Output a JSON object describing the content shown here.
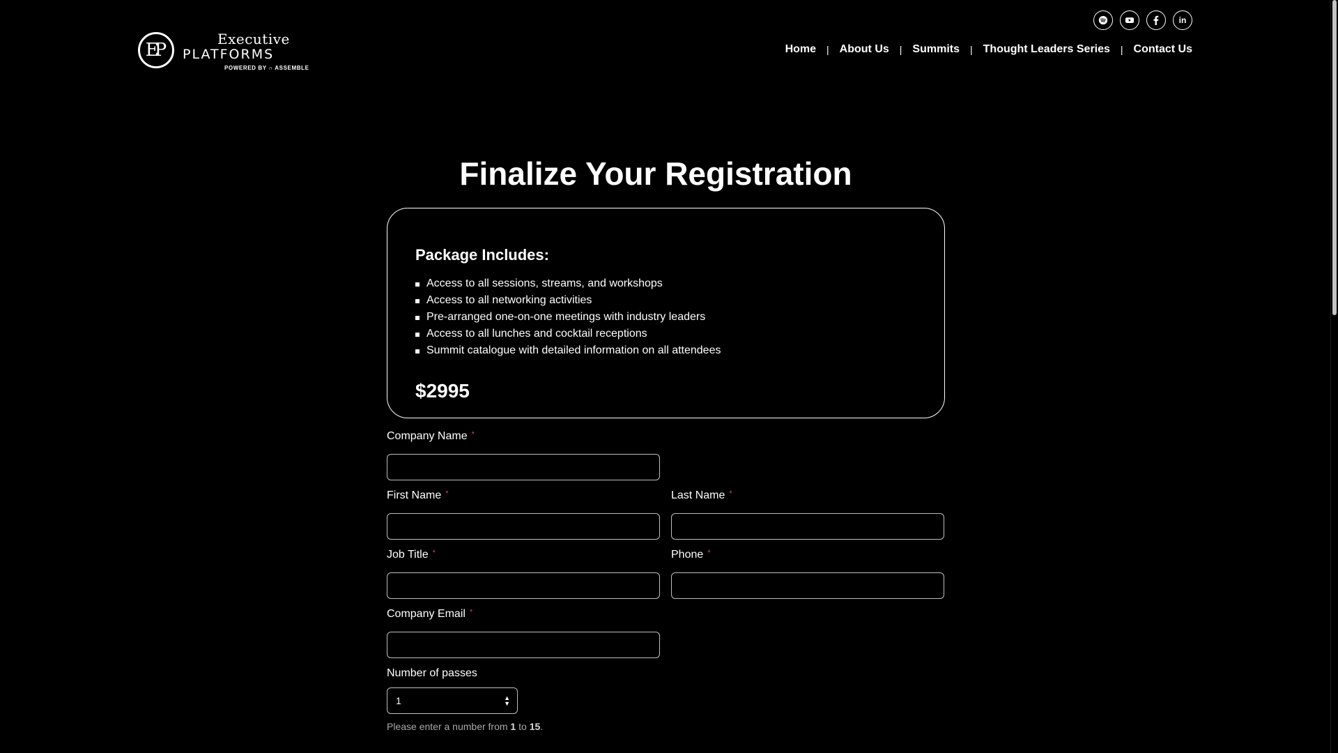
{
  "header": {
    "logo": {
      "line1": "Executive",
      "line2": "PLATFORMS",
      "line3": "POWERED BY ∩ ASSEMBLE"
    },
    "socials": [
      {
        "name": "spotify-icon"
      },
      {
        "name": "youtube-icon"
      },
      {
        "name": "facebook-icon"
      },
      {
        "name": "linkedin-icon",
        "label": "in"
      }
    ],
    "nav": {
      "home": "Home",
      "about": "About Us",
      "summits": "Summits",
      "thought_leaders": "Thought Leaders Series",
      "contact": "Contact Us",
      "separator": "|"
    }
  },
  "main": {
    "title": "Finalize Your Registration",
    "package": {
      "heading": "Package Includes:",
      "items": [
        "Access to all sessions, streams, and workshops",
        "Access to all networking activities",
        "Pre-arranged one-on-one meetings with industry leaders",
        "Access to all lunches and cocktail receptions",
        "Summit catalogue with detailed information on all attendees"
      ],
      "price": "$2995"
    },
    "form": {
      "required_marker": "*",
      "company_name": {
        "label": "Company Name",
        "value": ""
      },
      "first_name": {
        "label": "First Name",
        "value": ""
      },
      "last_name": {
        "label": "Last Name",
        "value": ""
      },
      "job_title": {
        "label": "Job Title",
        "value": ""
      },
      "phone": {
        "label": "Phone",
        "value": ""
      },
      "company_email": {
        "label": "Company Email",
        "value": ""
      },
      "passes": {
        "label": "Number of passes",
        "value": "1",
        "hint_prefix": "Please enter a number from ",
        "min": "1",
        "hint_mid": " to ",
        "max": "15",
        "hint_suffix": "."
      }
    }
  },
  "colors": {
    "background": "#000000",
    "text": "#ffffff",
    "required": "#d04a4a",
    "hint": "#a9a9a9"
  }
}
